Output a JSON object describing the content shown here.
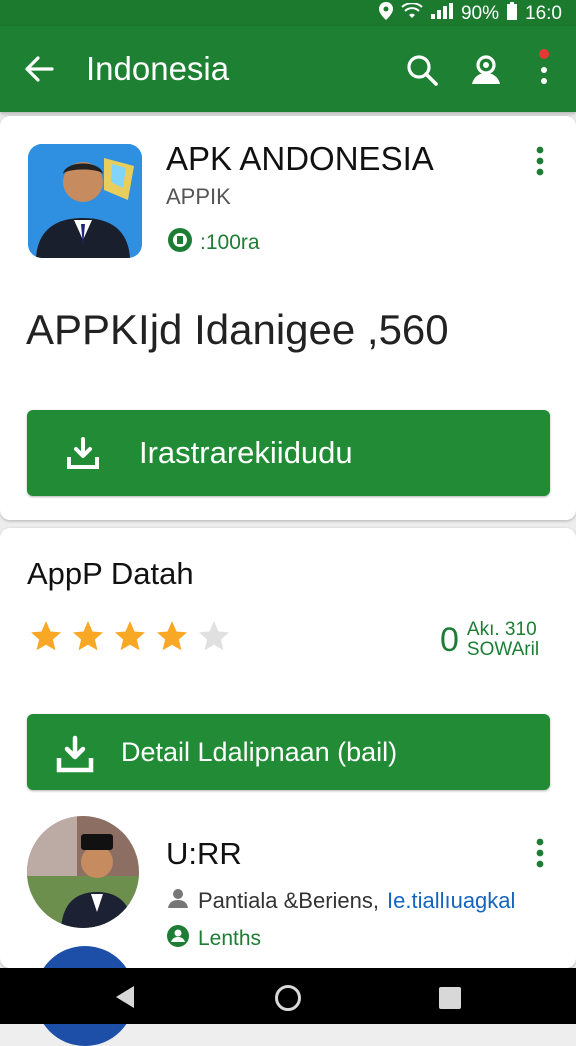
{
  "status_bar": {
    "battery": "90%",
    "time": "16:0"
  },
  "app_bar": {
    "title": "Indonesia",
    "icons": [
      "back-arrow-icon",
      "search-icon",
      "account-icon",
      "more-vert-icon"
    ]
  },
  "app_card": {
    "title": "APK ANDONESIA",
    "subtitle": "APPIK",
    "size": ":100ra",
    "headline": "APPKIjd Idanigee ,560",
    "install_button": "Irastrarekiidudu"
  },
  "detail_card": {
    "section_title": "AppP Datah",
    "rating_stars": 4,
    "rating_max": 5,
    "badge_mark": "0",
    "badge_line1": "Akı. 310",
    "badge_line2": "SOWAril",
    "detail_button": "Detail Ldalipnaan (bail)",
    "user": {
      "name": "U:RR",
      "line1_text": "Pantiala &Beriens,",
      "line1_link": "Ie.tiallıuagkal",
      "line2_text": "Lenths"
    }
  },
  "colors": {
    "primary": "#1e8033",
    "button": "#218c35",
    "star": "#f9a825",
    "star_empty": "#e0e0e0",
    "link": "#1565c0"
  }
}
